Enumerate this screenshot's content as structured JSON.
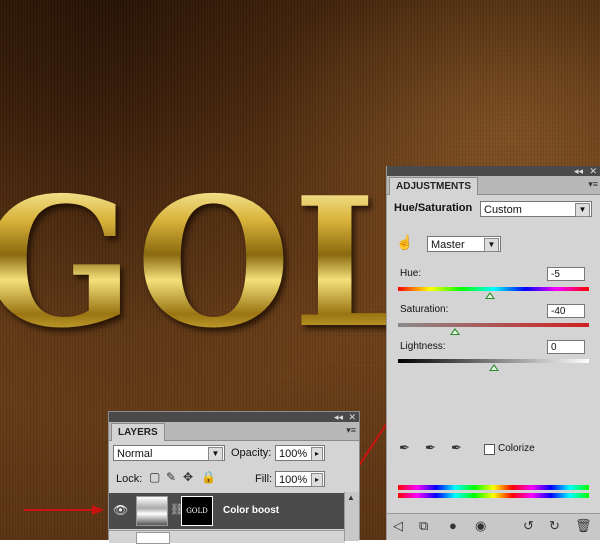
{
  "canvas": {
    "text": "GOLD"
  },
  "adjustments": {
    "tab_label": "ADJUSTMENTS",
    "title": "Hue/Saturation",
    "preset": "Custom",
    "channel": "Master",
    "hue_label": "Hue:",
    "hue_value": "-5",
    "saturation_label": "Saturation:",
    "saturation_value": "-40",
    "lightness_label": "Lightness:",
    "lightness_value": "0",
    "colorize_label": "Colorize"
  },
  "layers": {
    "tab_label": "LAYERS",
    "blend_mode": "Normal",
    "opacity_label": "Opacity:",
    "opacity_value": "100%",
    "lock_label": "Lock:",
    "fill_label": "Fill:",
    "fill_value": "100%",
    "layer_name": "Color boost",
    "mask_text": "GOLD"
  },
  "colors": {
    "arrow": "#cc1111",
    "layer_selected": "#4b4b4b",
    "panel": "#d4d4d4"
  },
  "icons": [
    "eye-icon",
    "link-icon",
    "brush-icon",
    "move-icon",
    "lock-icon",
    "hand-target-icon",
    "eyedropper-icon",
    "eyedropper-plus-icon",
    "eyedropper-minus-icon",
    "return-icon",
    "clip-icon",
    "mask-icon",
    "visibility-icon",
    "reset-icon",
    "refresh-icon",
    "trash-icon"
  ]
}
